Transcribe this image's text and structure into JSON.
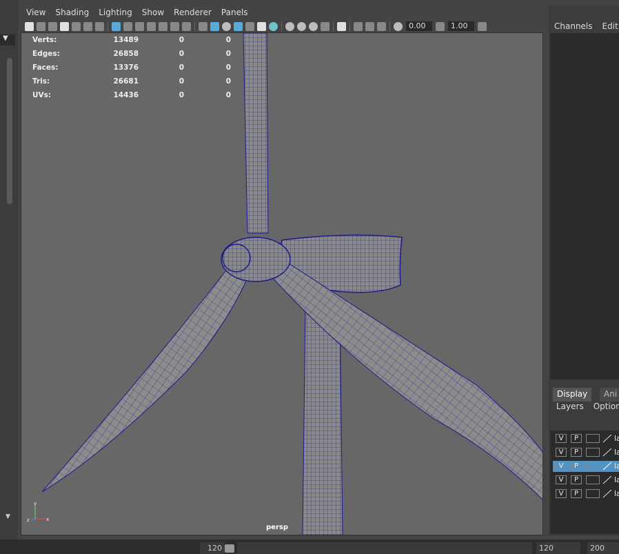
{
  "menu": {
    "view": "View",
    "shading": "Shading",
    "lighting": "Lighting",
    "show": "Show",
    "renderer": "Renderer",
    "panels": "Panels"
  },
  "toolbar": {
    "exposure": "0.00",
    "gamma": "1.00"
  },
  "hud": {
    "rows": [
      {
        "label": "Verts:",
        "total": "13489",
        "selected": "0",
        "sub": "0"
      },
      {
        "label": "Edges:",
        "total": "26858",
        "selected": "0",
        "sub": "0"
      },
      {
        "label": "Faces:",
        "total": "13376",
        "selected": "0",
        "sub": "0"
      },
      {
        "label": "Tris:",
        "total": "26681",
        "selected": "0",
        "sub": "0"
      },
      {
        "label": "UVs:",
        "total": "14436",
        "selected": "0",
        "sub": "0"
      }
    ]
  },
  "viewport": {
    "camera": "persp",
    "axis_x": "x",
    "axis_y": "y",
    "axis_z": "z",
    "background": "#676767",
    "wire_color": "#1a1a8c",
    "mesh_color": "#8a8a8a"
  },
  "channel_box": {
    "channels": "Channels",
    "edit": "Edit"
  },
  "layer_editor": {
    "tab_display": "Display",
    "tab_anim": "Ani",
    "menu_layers": "Layers",
    "menu_options": "Options",
    "layers": [
      {
        "v": "V",
        "p": "P",
        "name": "la",
        "selected": false
      },
      {
        "v": "V",
        "p": "P",
        "name": "la",
        "selected": false
      },
      {
        "v": "V",
        "p": "P",
        "name": "la",
        "selected": true
      },
      {
        "v": "V",
        "p": "P",
        "name": "la",
        "selected": false
      },
      {
        "v": "V",
        "p": "P",
        "name": "la",
        "selected": false
      }
    ]
  },
  "timeline": {
    "end_frame": "120",
    "range_end": "120",
    "range_max": "200"
  }
}
